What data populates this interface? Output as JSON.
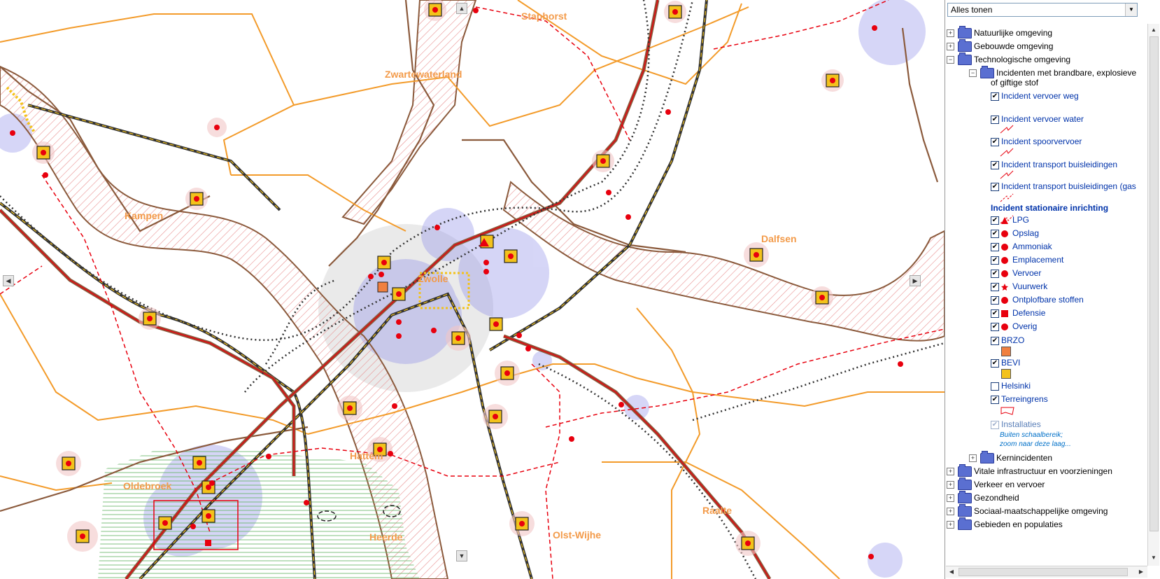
{
  "map": {
    "place_labels": [
      {
        "id": "staphorst",
        "text": "Staphorst"
      },
      {
        "id": "zwartewaterland",
        "text": "Zwartewaterland"
      },
      {
        "id": "kampen",
        "text": "Kampen"
      },
      {
        "id": "zwolle",
        "text": "Zwolle"
      },
      {
        "id": "dalfsen",
        "text": "Dalfsen"
      },
      {
        "id": "oldebroek",
        "text": "Oldebroek"
      },
      {
        "id": "hattem",
        "text": "Hattem"
      },
      {
        "id": "heerde",
        "text": "Heerde"
      },
      {
        "id": "olst-wijhe",
        "text": "Olst-Wijhe"
      },
      {
        "id": "raalte",
        "text": "Raalte"
      }
    ],
    "colors": {
      "municipality_border": "#f39b2a",
      "province_border": "#8b5a3c",
      "incident_dot": "#e8000e",
      "risk_zone": "#8a8ae8",
      "rail": "#333333",
      "hatch": "#e89090",
      "symbol_fill": "#f3c21b"
    },
    "pan_icons": {
      "up": "▲",
      "down": "▼",
      "left": "◀",
      "right": "▶"
    }
  },
  "panel": {
    "filter": {
      "value": "Alles tonen"
    },
    "tree": {
      "natuurlijke": "Natuurlijke omgeving",
      "gebouwde": "Gebouwde omgeving",
      "technologische": "Technologische omgeving",
      "incidenten_line1": "Incidenten met brandbare, explosieve",
      "incidenten_line2": "of giftige stof",
      "vervoer_weg": "Incident vervoer weg",
      "vervoer_water": "Incident vervoer water",
      "spoorvervoer": "Incident spoorvervoer",
      "buisleidingen": "Incident transport buisleidingen",
      "buisleidingen_gas": "Incident transport buisleidingen (gas",
      "stationaire": "Incident stationaire inrichting",
      "lpg": "LPG",
      "opslag": "Opslag",
      "ammoniak": "Ammoniak",
      "emplacement": "Emplacement",
      "vervoer": "Vervoer",
      "vuurwerk": "Vuurwerk",
      "ontplofbare": "Ontplofbare stoffen",
      "defensie": "Defensie",
      "overig": "Overig",
      "brzo": "BRZO",
      "bevi": "BEVI",
      "helsinki": "Helsinki",
      "terreingrens": "Terreingrens",
      "installaties": "Installaties",
      "note1": "Buiten schaalbereik;",
      "note2": "zoom naar deze laag...",
      "kernincidenten": "Kernincidenten",
      "vitale": "Vitale infrastructuur en voorzieningen",
      "verkeer": "Verkeer en vervoer",
      "gezondheid": "Gezondheid",
      "sociaal": "Sociaal-maatschappelijke omgeving",
      "gebieden": "Gebieden en populaties"
    },
    "expand_glyph": "+",
    "collapse_glyph": "−",
    "check_glyph": "✔"
  }
}
